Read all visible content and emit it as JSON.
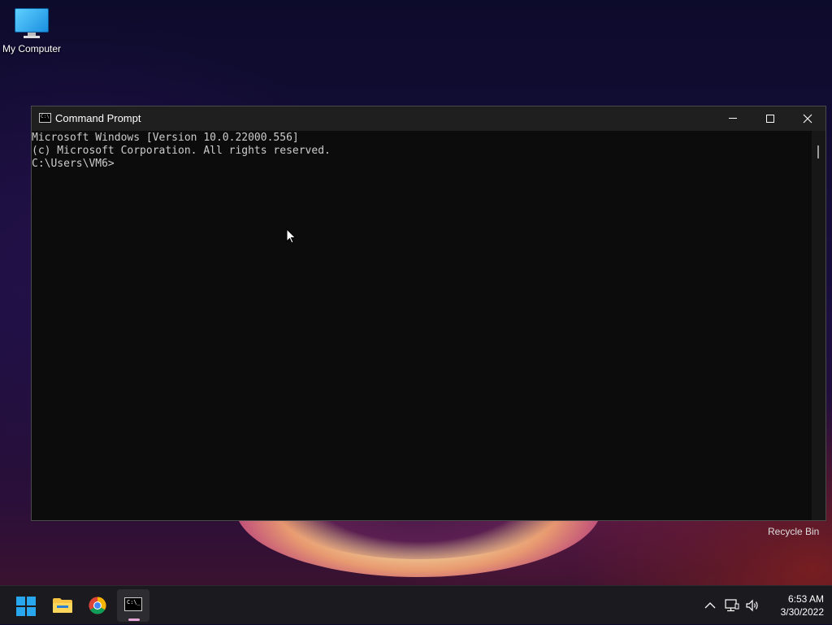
{
  "desktop": {
    "icons": [
      {
        "label": "My Computer"
      },
      {
        "label": "Recycle Bin"
      }
    ]
  },
  "window": {
    "title": "Command Prompt",
    "icon_text": "C:\\",
    "console_lines": [
      "Microsoft Windows [Version 10.0.22000.556]",
      "(c) Microsoft Corporation. All rights reserved.",
      "",
      "C:\\Users\\VM6>"
    ]
  },
  "taskbar": {
    "apps": [
      "start-icon",
      "file-explorer-icon",
      "chrome-icon",
      "command-prompt-icon"
    ],
    "cmd_icon_text": "C:\\_",
    "clock": {
      "time": "6:53 AM",
      "date": "3/30/2022"
    }
  },
  "colors": {
    "accent": "#29a7ee",
    "console_bg": "#0c0c0c",
    "console_fg": "#cccccc",
    "titlebar": "#1f1f1f",
    "taskbar": "#1b1b1f",
    "active_indicator": "#e7a6d8"
  }
}
